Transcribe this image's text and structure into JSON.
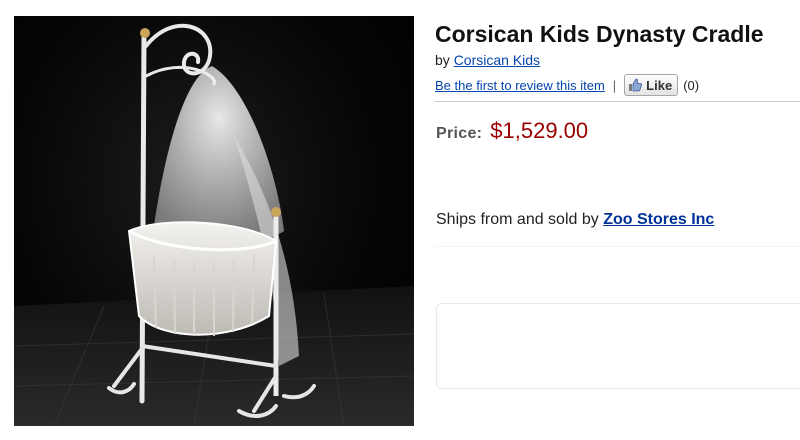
{
  "product": {
    "title": "Corsican Kids Dynasty Cradle",
    "by_prefix": "by",
    "brand": "Corsican Kids",
    "review_link": "Be the first to review this item",
    "separator": "|",
    "like_label": "Like",
    "like_count": "(0)",
    "price_label": "Price:",
    "price": "$1,529.00",
    "ships_text": "Ships from and sold by",
    "seller": "Zoo Stores Inc"
  },
  "image": {
    "icon": "cradle-photo"
  },
  "colors": {
    "link": "#0645ad",
    "price": "#990000",
    "seller_link": "#003399"
  }
}
